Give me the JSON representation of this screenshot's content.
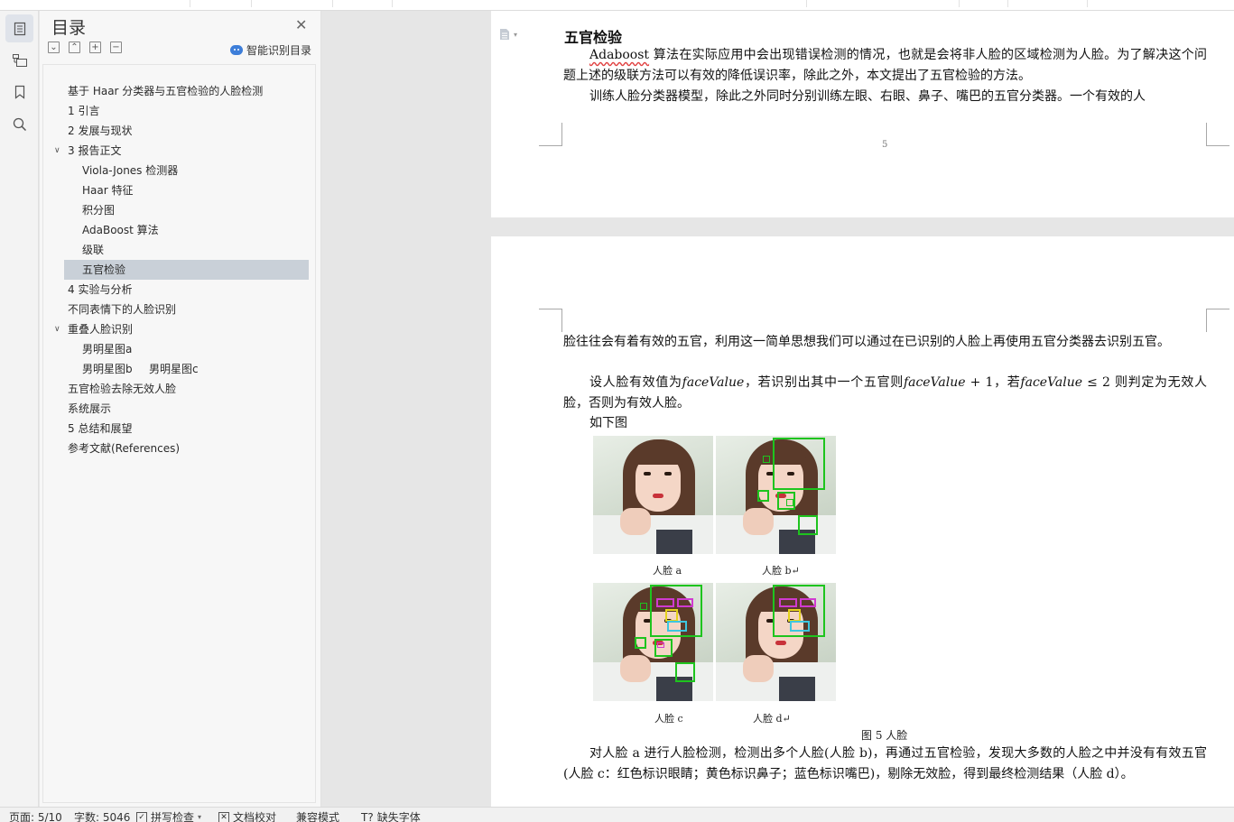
{
  "toc": {
    "title": "目录",
    "smart_label": "智能识别目录",
    "items": [
      {
        "label": "基于 Haar 分类器与五官检验的人脸检测"
      },
      {
        "label": "1 引言"
      },
      {
        "label": "2 发展与现状"
      },
      {
        "label": "3 报告正文"
      },
      {
        "label": "Viola-Jones 检测器"
      },
      {
        "label": "Haar 特征"
      },
      {
        "label": "积分图"
      },
      {
        "label": "AdaBoost 算法"
      },
      {
        "label": "级联"
      },
      {
        "label": "五官检验"
      },
      {
        "label": "4 实验与分析"
      },
      {
        "label": "不同表情下的人脸识别"
      },
      {
        "label": "重叠人脸识别"
      },
      {
        "label": "男明星图a"
      },
      {
        "label": "男明星图b"
      },
      {
        "label": "男明星图c"
      },
      {
        "label": "五官检验去除无效人脸"
      },
      {
        "label": "系统展示"
      },
      {
        "label": "5 总结和展望"
      },
      {
        "label": "参考文献(References)"
      }
    ]
  },
  "document": {
    "page1": {
      "heading": "五官检验",
      "para1_word": "Adaboost",
      "para1_rest": " 算法在实际应用中会出现错误检测的情况，也就是会将非人脸的区域检测为人脸。为了解决这个问题上述的级联方法可以有效的降低误识率，除此之外，本文提出了五官检验的方法。",
      "para2": "训练人脸分类器模型，除此之外同时分别训练左眼、右眼、鼻子、嘴巴的五官分类器。一个有效的人",
      "page_number": "5"
    },
    "page2": {
      "para1": "脸往往会有着有效的五官，利用这一简单思想我们可以通过在已识别的人脸上再使用五官分类器去识别五官。",
      "para2_a": "设人脸有效值为",
      "para2_m1": "faceValue",
      "para2_b": "，若识别出其中一个五官则",
      "para2_m2": "faceValue",
      "para2_c": " + 1，若",
      "para2_m3": "faceValue",
      "para2_d": " ≤ 2 则判定为无效人脸，否则为有效人脸。",
      "para3": "如下图",
      "captions": [
        "人脸 a",
        "人脸 b↵",
        "人脸 c",
        "人脸 d↵"
      ],
      "figure_caption": "图 5 人脸",
      "para4": "对人脸 a 进行人脸检测，检测出多个人脸(人脸 b)，再通过五官检验，发现大多数的人脸之中并没有有效五官(人脸 c：红色标识眼睛；黄色标识鼻子；蓝色标识嘴巴)，剔除无效脸，得到最终检测结果（人脸 d）。"
    }
  },
  "statusbar": {
    "page": "页面: 5/10",
    "words": "字数: 5046",
    "spell": "拼写检查",
    "proof": "文档校对",
    "compat": "兼容模式",
    "missing_font": "缺失字体"
  },
  "icons": [
    "toc-icon",
    "structure-icon",
    "bookmark-icon",
    "search-icon",
    "close-icon",
    "collapse-all-icon",
    "expand-all-icon",
    "add-icon",
    "remove-icon",
    "smart-toc-icon",
    "document-icon"
  ],
  "colors": {
    "selected_toc": "#c9d0d8",
    "detect_green": "#1ec41e",
    "eye_red": "#d03ad0",
    "nose_yellow": "#e4d21c",
    "mouth_blue": "#3dc6e0"
  }
}
